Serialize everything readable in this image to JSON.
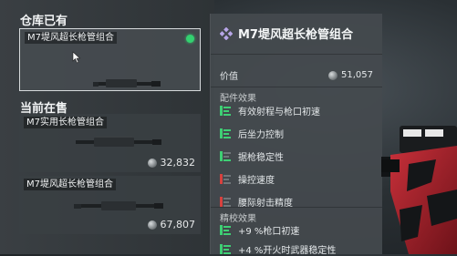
{
  "owned": {
    "title": "仓库已有",
    "item": {
      "name": "M7堤风超长枪管组合",
      "status": "equipped"
    }
  },
  "market": {
    "title": "当前在售",
    "items": [
      {
        "name": "M7实用长枪管组合",
        "price": "32,832"
      },
      {
        "name": "M7堤风超长枪管组合",
        "price": "67,807"
      }
    ]
  },
  "detail": {
    "title": "M7堤风超长枪管组合",
    "price_label": "价值",
    "price": "51,057",
    "effects_label": "配件效果",
    "effects": [
      {
        "text": "有效射程与枪口初速",
        "kind": "positive",
        "color": "#3ecf74"
      },
      {
        "text": "后坐力控制",
        "kind": "positive",
        "color": "#3ecf74"
      },
      {
        "text": "据枪稳定性",
        "kind": "mixed",
        "color": "#3ecf74"
      },
      {
        "text": "操控速度",
        "kind": "negative",
        "color": "#d9413f"
      },
      {
        "text": "腰际射击精度",
        "kind": "negative",
        "color": "#d9413f"
      }
    ],
    "tuning_label": "精校效果",
    "tuning": [
      {
        "text": "+9 %枪口初速",
        "color": "#3ecf74"
      },
      {
        "text": "+4 %开火时武器稳定性",
        "color": "#3ecf74"
      }
    ]
  },
  "colors": {
    "accent_green": "#3ecf74",
    "accent_red": "#d9413f",
    "status_green": "#33d170"
  }
}
